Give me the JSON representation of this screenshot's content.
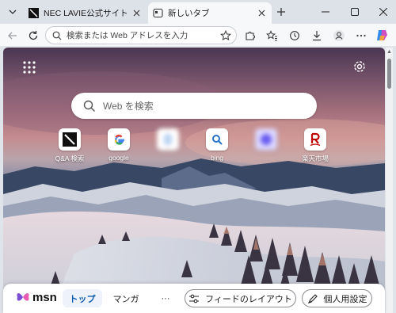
{
  "tabs": [
    {
      "title": "NEC LAVIE公式サイト > サービス",
      "active": false
    },
    {
      "title": "新しいタブ",
      "active": true
    }
  ],
  "address_bar": {
    "placeholder": "検索または Web アドレスを入力"
  },
  "ntp": {
    "search_placeholder": "Web を検索",
    "quick_links": [
      {
        "label": "Q&A 検索",
        "icon": "nec-qa-icon"
      },
      {
        "label": "google",
        "icon": "google-icon"
      },
      {
        "label": "",
        "icon": "blurred-icon"
      },
      {
        "label": "bing",
        "icon": "bing-icon"
      },
      {
        "label": "",
        "icon": "blurred-icon"
      },
      {
        "label": "楽天市場",
        "icon": "rakuten-icon"
      }
    ]
  },
  "msn_bar": {
    "logo": "msn",
    "tabs": [
      "トップ",
      "マンガ"
    ],
    "more": "···",
    "layout_button": "フィードのレイアウト",
    "personalize_button": "個人用設定"
  },
  "colors": {
    "accent": "#0f5bb5",
    "msn_butterfly": "#7b4fd6",
    "rakuten": "#bf0000"
  }
}
